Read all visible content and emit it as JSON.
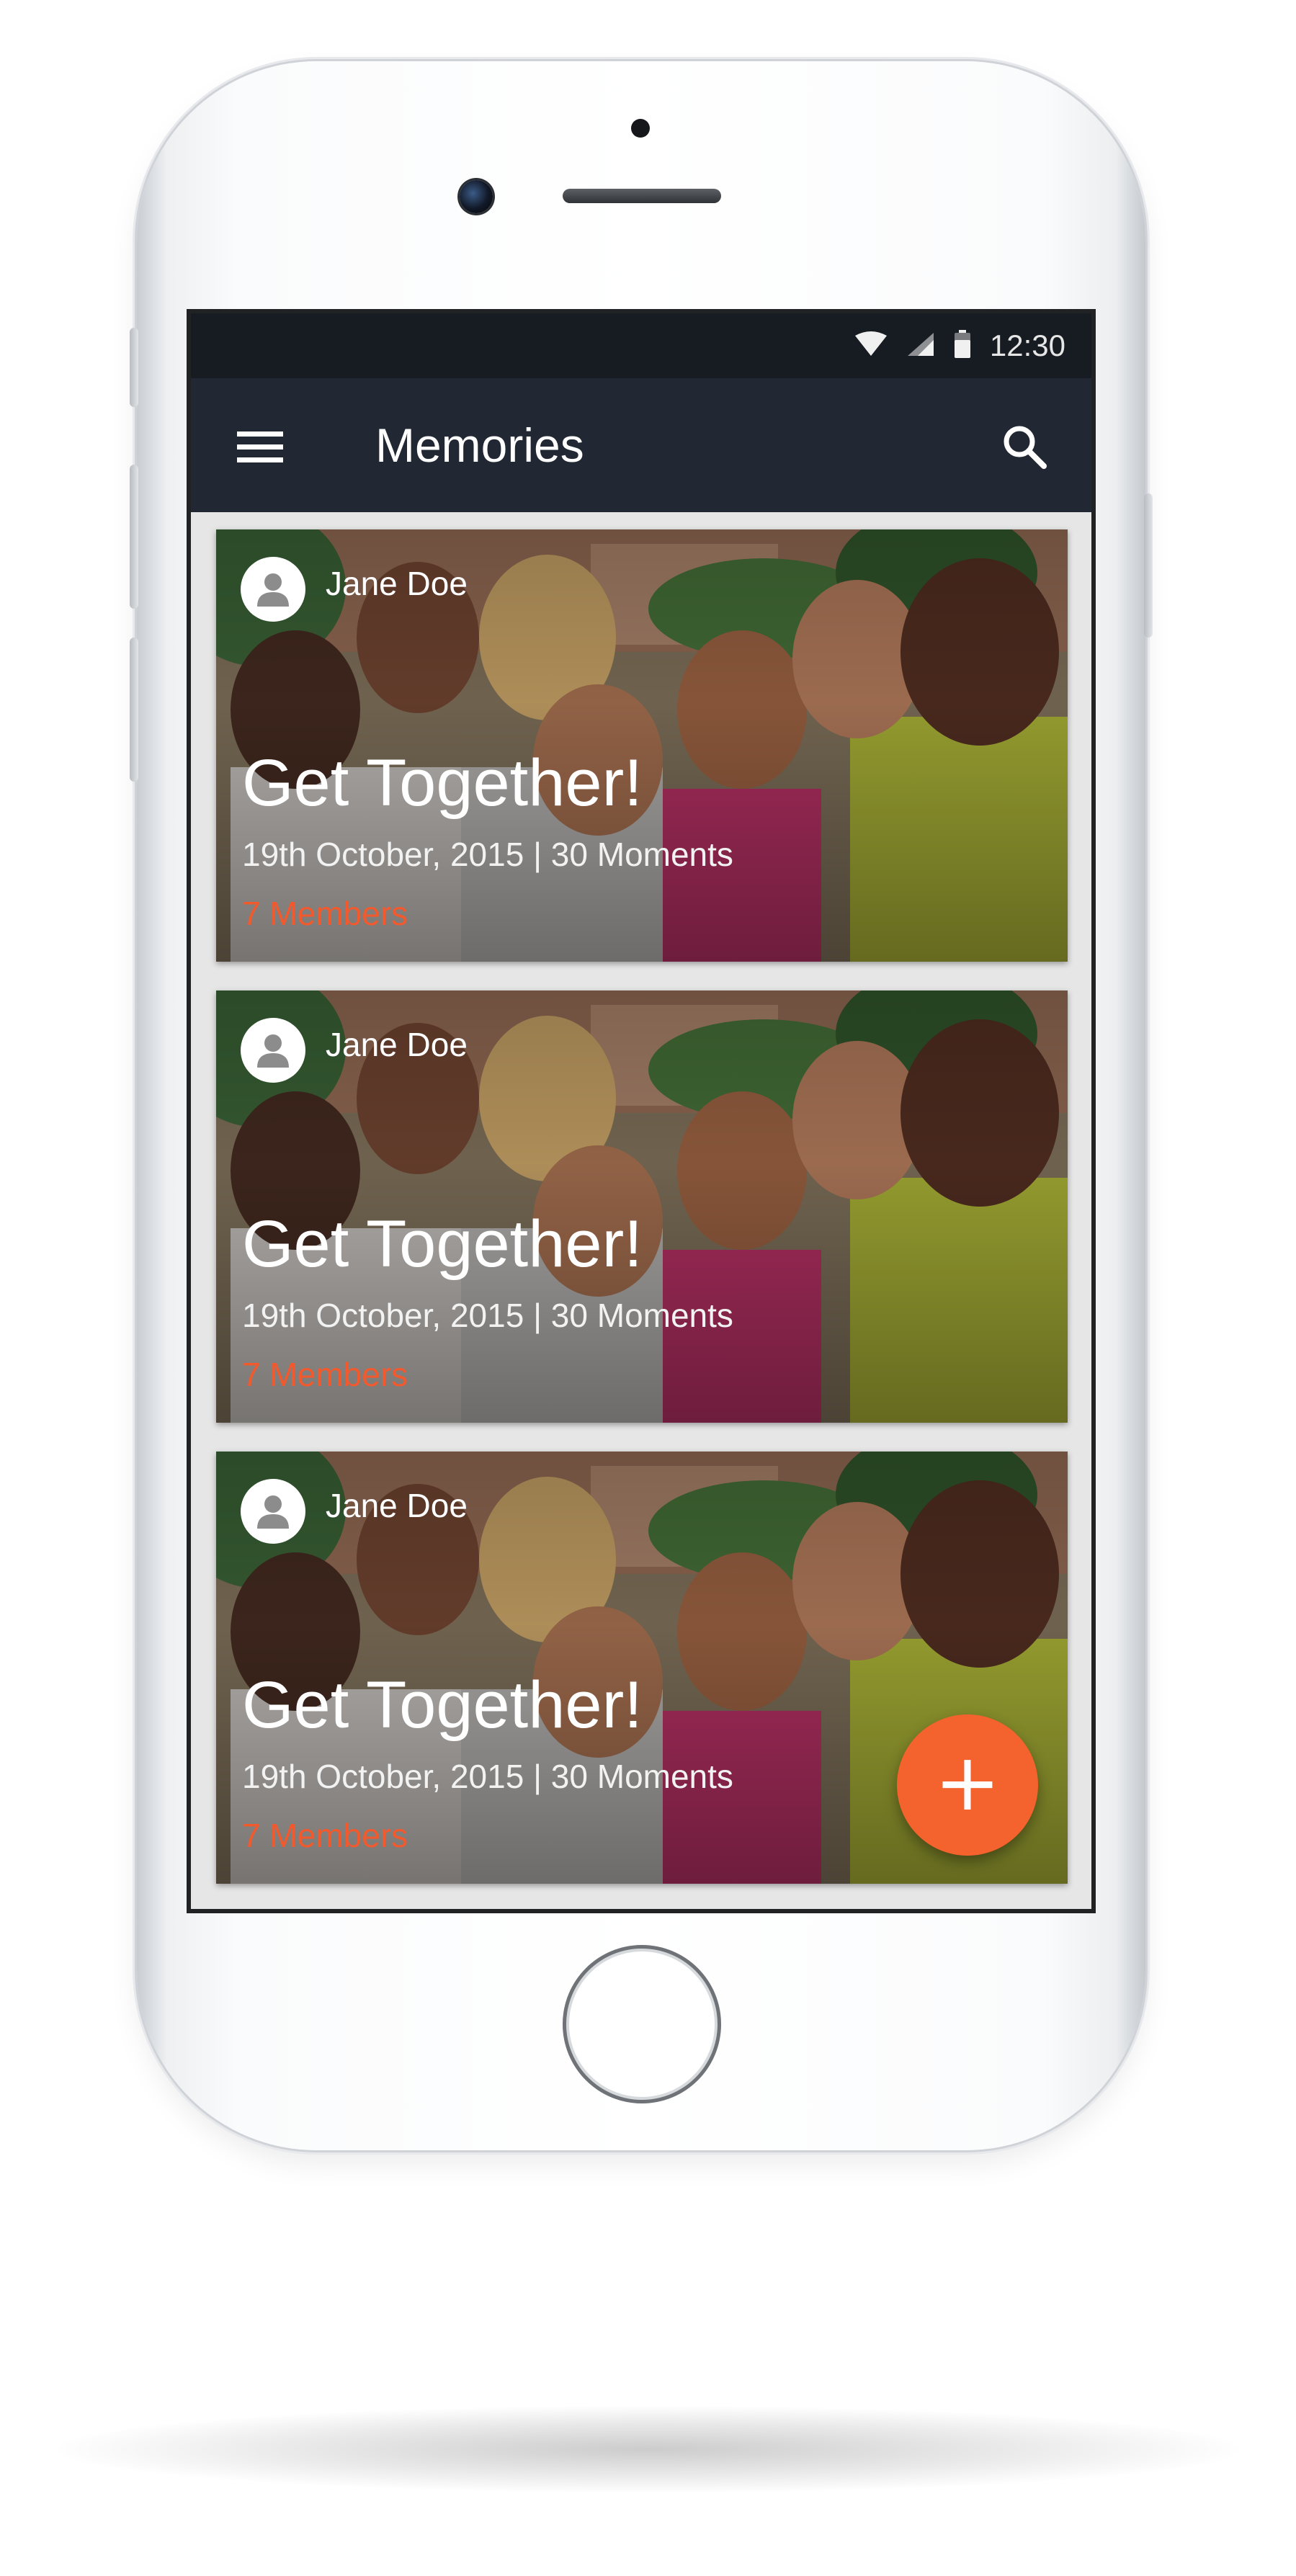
{
  "status_bar": {
    "time": "12:30",
    "icons": [
      "wifi-icon",
      "signal-icon",
      "battery-icon"
    ]
  },
  "app_bar": {
    "title": "Memories",
    "menu_icon": "menu-icon",
    "search_icon": "search-icon"
  },
  "memories": [
    {
      "author": "Jane Doe",
      "title": "Get Together!",
      "meta": "19th October, 2015 | 30 Moments",
      "members": "7 Members"
    },
    {
      "author": "Jane Doe",
      "title": "Get Together!",
      "meta": "19th October, 2015 | 30 Moments",
      "members": "7 Members"
    },
    {
      "author": "Jane Doe",
      "title": "Get Together!",
      "meta": "19th October, 2015 | 30 Moments",
      "members": "7 Members"
    }
  ],
  "fab": {
    "label": "+",
    "icon": "plus-icon"
  },
  "colors": {
    "status_bar": "#171b22",
    "app_bar": "#222833",
    "accent": "#f4622d",
    "members_text": "#f25a2e",
    "feed_background": "#e6e6e6"
  }
}
